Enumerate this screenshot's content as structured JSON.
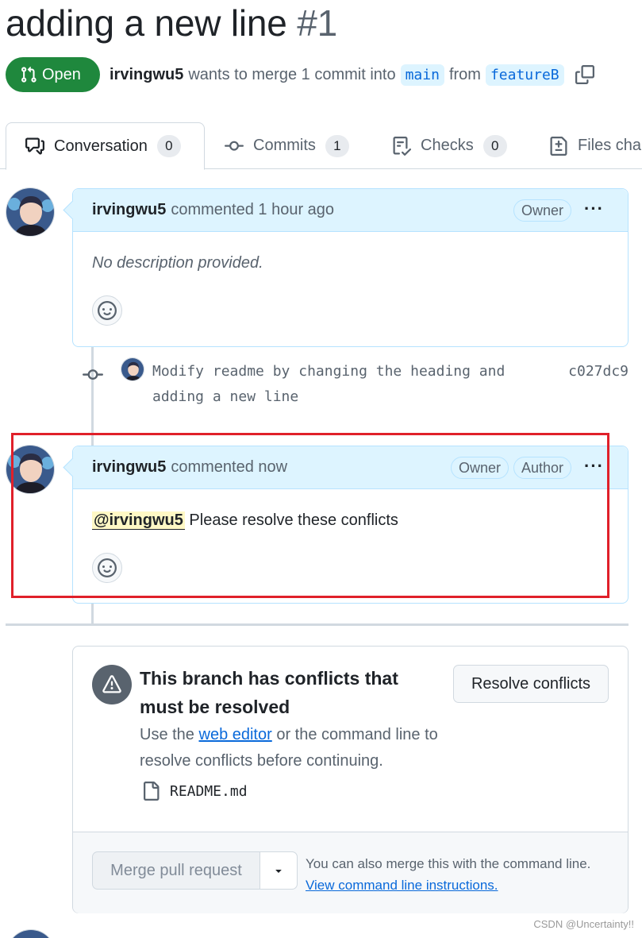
{
  "pr": {
    "title": "adding a new line",
    "number": "#1",
    "state": "Open",
    "author": "irvingwu5",
    "merge_text": "wants to merge 1 commit into",
    "base_branch": "main",
    "from_text": "from",
    "head_branch": "featureB"
  },
  "tabs": [
    {
      "label": "Conversation",
      "count": "0"
    },
    {
      "label": "Commits",
      "count": "1"
    },
    {
      "label": "Checks",
      "count": "0"
    },
    {
      "label": "Files cha"
    }
  ],
  "comments": [
    {
      "author": "irvingwu5",
      "action": "commented 1 hour ago",
      "badges": [
        "Owner"
      ],
      "body": "No description provided."
    },
    {
      "author": "irvingwu5",
      "action": "commented now",
      "badges": [
        "Owner",
        "Author"
      ],
      "mention": "@irvingwu5",
      "body": "Please resolve these conflicts"
    }
  ],
  "commit": {
    "message_line1": "Modify readme by changing the heading and",
    "message_line2": "adding a new line",
    "sha": "c027dc9"
  },
  "merge": {
    "title": "This branch has conflicts that must be resolved",
    "desc_prefix": "Use the",
    "desc_link": "web editor",
    "desc_suffix": "or the command line to resolve conflicts before continuing.",
    "resolve_button": "Resolve conflicts",
    "file": "README.md",
    "merge_button": "Merge pull request",
    "note": "You can also merge this with the command line.",
    "note_link": "View command line instructions."
  },
  "watermark": "CSDN @Uncertainty!!",
  "colors": {
    "open_green": "#1f883d",
    "link_blue": "#0969da",
    "highlight_red": "#e0202a"
  }
}
